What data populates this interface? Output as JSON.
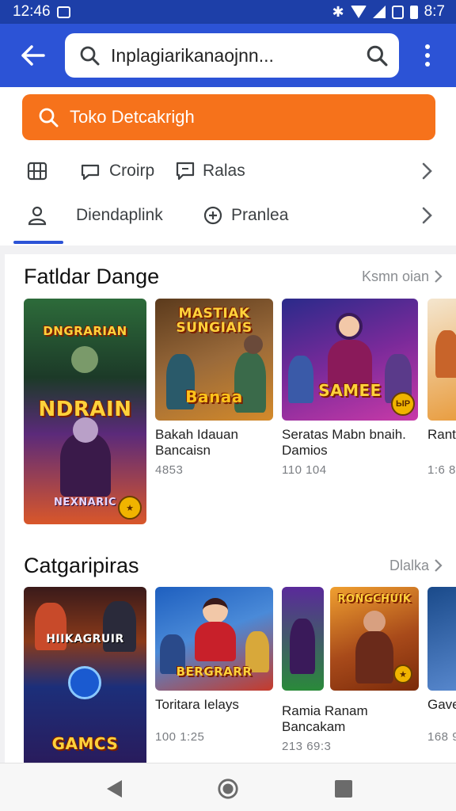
{
  "status_bar": {
    "time": "12:46",
    "battery_text": "8:7"
  },
  "search": {
    "query": "Inplagiarikanaojnn..."
  },
  "filters": {
    "primary_button": "Toko Detcakrigh",
    "row1": [
      {
        "label": "",
        "icon": "tag-icon"
      },
      {
        "label": "Croirp",
        "icon": "chat-bubble-icon"
      },
      {
        "label": "Ralas",
        "icon": "message-square-icon"
      }
    ],
    "row2": [
      {
        "label": "Diendaplink",
        "icon": "person-icon"
      },
      {
        "label": "Pranlea",
        "icon": "plus-circle-icon"
      }
    ]
  },
  "section1": {
    "title": "Fatldar Dange",
    "see_all": "Ksmn oian",
    "feature_art": {
      "top_text": "DNGRARIAN",
      "mid_text": "NDRAIN",
      "bottom_text": "NEXNARIC",
      "colors": [
        "#2d6b3a",
        "#5b2a7a",
        "#d9572a"
      ]
    },
    "items": [
      {
        "title": "Bakah Idauan\nBancaisn",
        "meta": "4853",
        "art_text": "MASTIAK\nSUNGIAIS",
        "art_badge": "Banaa",
        "colors": [
          "#5b3a1c",
          "#d48a2a"
        ]
      },
      {
        "title": "Seratas Mabn bnaih.\nDamios",
        "meta": "110 104",
        "art_text": "SAMEE",
        "art_badge": "ЫP",
        "colors": [
          "#2a2a8a",
          "#c93aa8"
        ]
      },
      {
        "title": "Rant",
        "meta": "1:6 8",
        "colors": [
          "#f4e6cf",
          "#e89a3a"
        ]
      }
    ]
  },
  "section2": {
    "title": "Catgaripiras",
    "see_all": "Dlalka",
    "feature_art": {
      "top_text": "HIIKAGRUIR",
      "bottom_text": "GAMCS",
      "colors": [
        "#3a1a1a",
        "#1c2f7a"
      ]
    },
    "items": [
      {
        "title": "Toritara Ielays",
        "meta": "100 1:25",
        "art_text": "BERGRARR",
        "colors": [
          "#1e5fbf",
          "#c73a2a"
        ]
      },
      {
        "title": "Ramia Ranam\nBancakam",
        "meta": "213 69:3",
        "art_text": "",
        "colors": [
          "#5a2a9a",
          "#2a8a3a"
        ]
      },
      {
        "title": "",
        "meta": "",
        "art_text": "RONGCHUIK",
        "colors": [
          "#7a2a0a",
          "#f0a030"
        ]
      },
      {
        "title": "Gave",
        "meta": "168 9",
        "colors": [
          "#1a4a8a",
          "#5a8ad0"
        ]
      }
    ]
  },
  "colors": {
    "status_bar": "#1d3fa8",
    "app_bar": "#2c53d6",
    "orange": "#f6721b"
  }
}
